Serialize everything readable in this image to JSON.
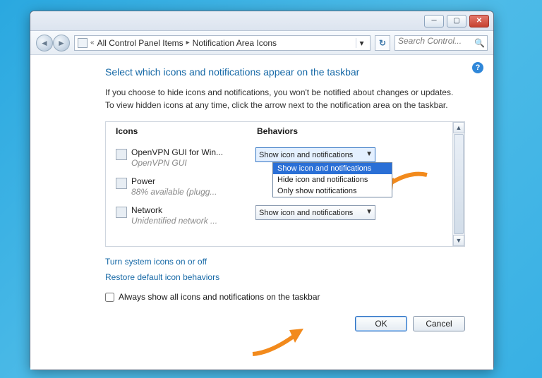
{
  "breadcrumb": {
    "root": "All Control Panel Items",
    "current": "Notification Area Icons"
  },
  "search": {
    "placeholder": "Search Control..."
  },
  "heading": "Select which icons and notifications appear on the taskbar",
  "description": "If you choose to hide icons and notifications, you won't be notified about changes or updates. To view hidden icons at any time, click the arrow next to the notification area on the taskbar.",
  "cols": {
    "icons": "Icons",
    "behaviors": "Behaviors"
  },
  "rows": [
    {
      "name": "OpenVPN GUI for Win...",
      "sub": "OpenVPN GUI",
      "value": "Show icon and notifications"
    },
    {
      "name": "Power",
      "sub": "88% available (plugg...",
      "value": ""
    },
    {
      "name": "Network",
      "sub": "Unidentified network ...",
      "value": "Show icon and notifications"
    }
  ],
  "dropdown": {
    "opt1": "Show icon and notifications",
    "opt2": "Hide icon and notifications",
    "opt3": "Only show notifications"
  },
  "links": {
    "system": "Turn system icons on or off",
    "restore": "Restore default icon behaviors"
  },
  "checkbox": {
    "label": "Always show all icons and notifications on the taskbar"
  },
  "buttons": {
    "ok": "OK",
    "cancel": "Cancel"
  }
}
